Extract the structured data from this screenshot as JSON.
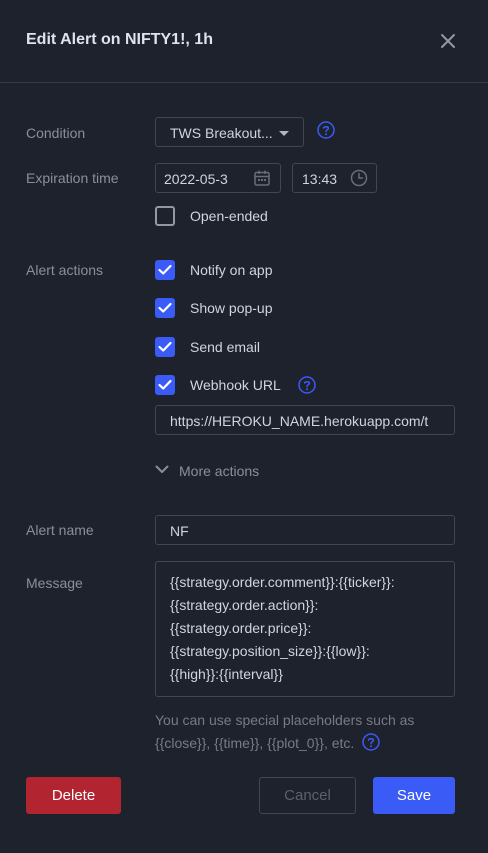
{
  "dialog": {
    "title": "Edit Alert on NIFTY1!, 1h",
    "close_icon": "close-icon"
  },
  "condition": {
    "label": "Condition",
    "value": "TWS Breakout...",
    "icon": "chevron-down-icon",
    "help_icon": "question-circle-icon"
  },
  "expiration": {
    "label": "Expiration time",
    "date_value": "2022-05-3",
    "date_icon": "calendar-icon",
    "time_value": "13:43",
    "time_icon": "clock-icon",
    "open_ended_label": "Open-ended",
    "open_ended_checked": false
  },
  "alert_actions": {
    "label": "Alert actions",
    "items": [
      {
        "label": "Notify on app",
        "checked": true
      },
      {
        "label": "Show pop-up",
        "checked": true
      },
      {
        "label": "Send email",
        "checked": true
      },
      {
        "label": "Webhook URL",
        "checked": true
      }
    ],
    "webhook_help_icon": "question-circle-icon",
    "webhook_url": "https://HEROKU_NAME.herokuapp.com/t",
    "more_actions_label": "More actions"
  },
  "alert_name": {
    "label": "Alert name",
    "value": "NF"
  },
  "message": {
    "label": "Message",
    "value": "{{strategy.order.comment}}:{{ticker}}:{{strategy.order.action}}:{{strategy.order.price}}:{{strategy.position_size}}:{{low}}:{{high}}:{{interval}}",
    "lines": [
      "{{strategy.order.comment}}:{{ticker}}:",
      "{{strategy.order.action}}:",
      "{{strategy.order.price}}:",
      "{{strategy.position_size}}:{{low}}:",
      "{{high}}:{{interval}}"
    ],
    "hint": "You can use special placeholders such as {{close}}, {{time}}, {{plot_0}}, etc."
  },
  "buttons": {
    "delete": "Delete",
    "cancel": "Cancel",
    "save": "Save"
  },
  "colors": {
    "background": "#1e222d",
    "accent": "#3a5bf5",
    "danger": "#b2242f",
    "border": "#434651",
    "muted_text": "#8b8f9a"
  }
}
